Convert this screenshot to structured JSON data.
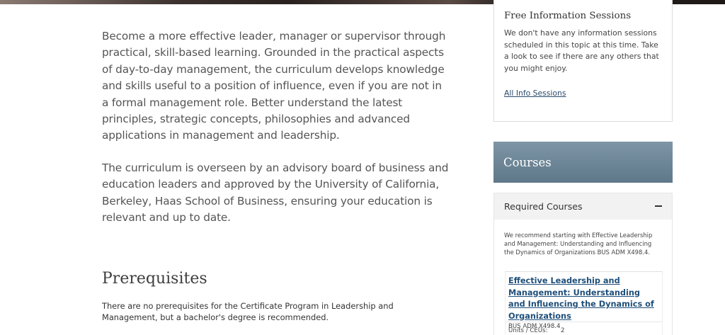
{
  "hero": {
    "image_name": "hero-photo-strip"
  },
  "main": {
    "intro_paragraphs": [
      "Become a more effective leader, manager or supervisor through practical, skill-based learning. Grounded in the practical aspects of day-to-day management, the curriculum develops knowledge and skills useful to a position of influence, even if you are not in a formal management role. Better understand the latest principles, strategic concepts, philosophies and advanced applications in management and leadership.",
      "The curriculum is overseen by an advisory board of business and education leaders and approved by the University of California, Berkeley, Haas School of Business, ensuring your education is relevant and up to date."
    ],
    "prerequisites": {
      "heading": "Prerequisites",
      "text": "There are no prerequisites for the Certificate Program in Leadership and Management, but a bachelor's degree is recommended."
    }
  },
  "sidebar": {
    "info_sessions": {
      "title": "Free Information Sessions",
      "text": "We don't have any information sessions scheduled in this topic at this time. Take a look to see if there are any others that you might enjoy.",
      "link_label": "All Info Sessions"
    },
    "courses": {
      "title": "Courses",
      "required": {
        "title": "Required Courses",
        "toggle_icon": "minus-icon",
        "note": "We recommend starting with Effective Leadership and Management: Understanding and Influencing the Dynamics of Organizations BUS ADM X498.4.",
        "items": [
          {
            "title": "Effective Leadership and Management: Understanding and Influencing the Dynamics of Organizations",
            "code": "BUS ADM X498.4",
            "units_label": "Units / CEUs:",
            "units_value": "2"
          }
        ]
      }
    }
  },
  "colors": {
    "courses_header": "#6f889a",
    "link": "#1f4f7a",
    "body_text": "#555555"
  }
}
